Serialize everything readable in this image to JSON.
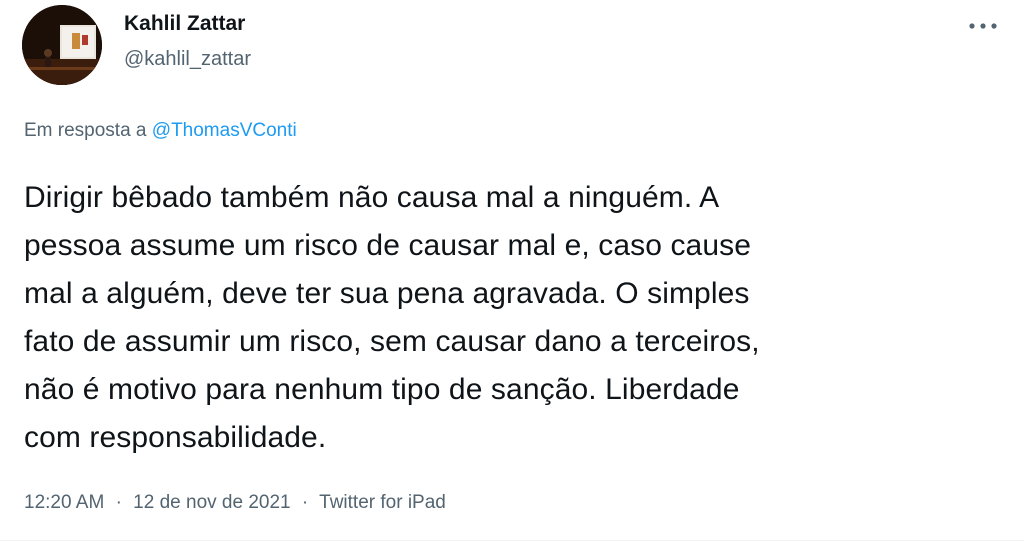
{
  "author": {
    "name": "Kahlil Zattar",
    "handle": "@kahlil_zattar"
  },
  "reply": {
    "prefix": "Em resposta a ",
    "mention": "@ThomasVConti"
  },
  "tweet": {
    "text": "Dirigir bêbado também não causa mal a ninguém. A\npessoa assume um risco de causar mal e, caso cause\nmal a alguém, deve ter sua pena agravada. O simples\nfato de assumir um risco, sem causar dano a terceiros,\nnão é motivo para nenhum tipo de sanção. Liberdade\ncom responsabilidade."
  },
  "meta": {
    "time": "12:20 AM",
    "separator": "·",
    "date": "12 de nov de 2021",
    "source": "Twitter for iPad"
  },
  "icons": {
    "more": "more-icon",
    "avatar": "avatar-photo"
  },
  "colors": {
    "link": "#1d9bf0",
    "secondary_text": "#536471",
    "primary_text": "#0f1419"
  }
}
